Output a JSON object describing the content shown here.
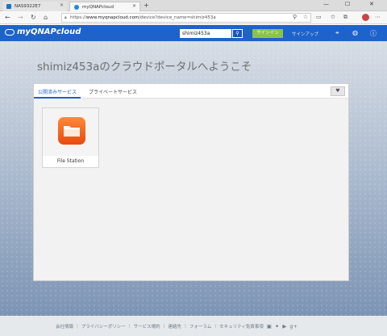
{
  "browser": {
    "tabs": [
      {
        "title": "NAS9322E7",
        "active": false
      },
      {
        "title": "myQNAPcloud",
        "active": true
      }
    ],
    "new_tab": "+",
    "window_controls": [
      "—",
      "☐",
      "✕"
    ],
    "url_prefix": "https://",
    "url_host": "www.myqnapcloud.com",
    "url_path": "/device?device_name=shimiz453a"
  },
  "header": {
    "logo": "myQNAPcloud",
    "search_value": "shimiz453a",
    "signin_label": "サインイン",
    "signup_label": "サインアップ"
  },
  "main": {
    "welcome": "shimiz453aのクラウドポータルへようこそ",
    "tabs": [
      "公開済みサービス",
      "プライベートサービス"
    ],
    "apps": [
      {
        "name": "File Station",
        "icon": "folder-icon",
        "color": "#f26b1d"
      }
    ]
  },
  "footer": {
    "links": [
      "会社情報",
      "プライバシーポリシー",
      "サービス規約",
      "連絡先",
      "フォーラム",
      "セキュリティ免責事項"
    ]
  },
  "colors": {
    "brand": "#1e63c9",
    "signin": "#8bc34a"
  }
}
